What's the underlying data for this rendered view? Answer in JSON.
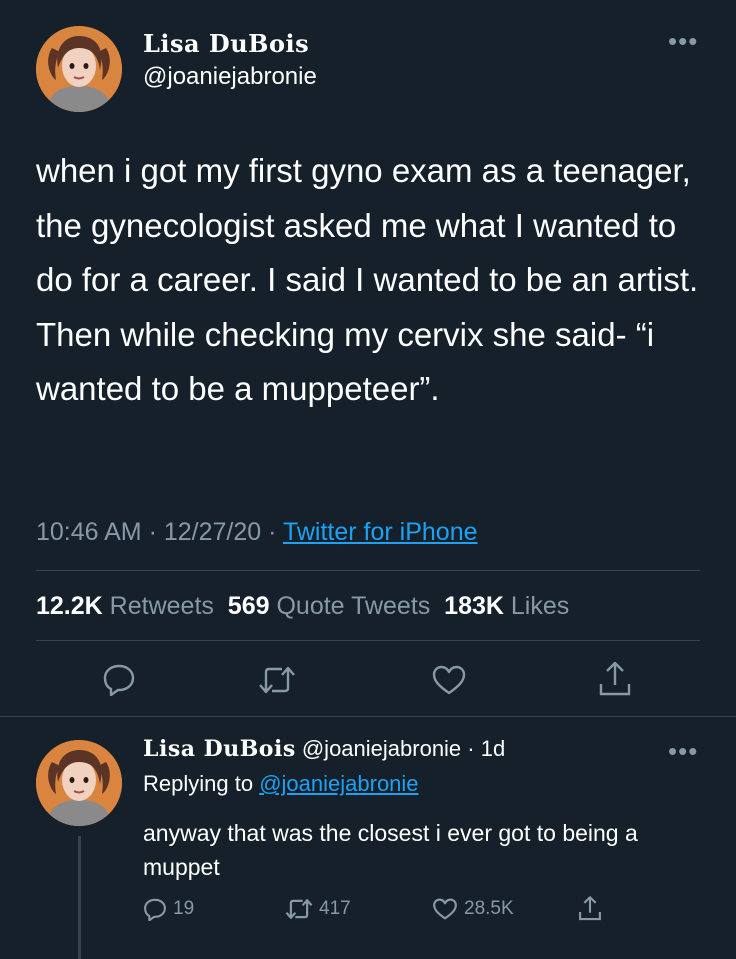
{
  "tweet": {
    "display_name": "Lisa DuBois",
    "handle": "@joaniejabronie",
    "more_icon": "more-icon",
    "text": "when i got my first gyno exam as a teenager, the gynecologist asked me what I wanted to do for a career. I said I wanted to be an artist. Then while checking my cervix she said- “i wanted to be a muppeteer”.",
    "time": "10:46 AM",
    "sep": "·",
    "date": "12/27/20",
    "source": "Twitter for iPhone",
    "stats": {
      "retweets_count": "12.2K",
      "retweets_label": "Retweets",
      "quotes_count": "569",
      "quotes_label": "Quote Tweets",
      "likes_count": "183K",
      "likes_label": "Likes"
    },
    "actions": [
      "reply-icon",
      "retweet-icon",
      "like-icon",
      "share-icon"
    ]
  },
  "reply": {
    "display_name": "Lisa DuBois",
    "handle": "@joaniejabronie",
    "age_sep": "·",
    "age": "1d",
    "replying_prefix": "Replying to",
    "replying_handle": "@joaniejabronie",
    "text": "anyway that was the closest i ever got to being a muppet",
    "counts": {
      "replies": "19",
      "retweets": "417",
      "likes": "28.5K"
    }
  },
  "colors": {
    "background": "#15202b",
    "muted": "#8899a6",
    "accent": "#1da1f2",
    "divider": "#38444d",
    "avatar_bg": "#d9843f"
  }
}
